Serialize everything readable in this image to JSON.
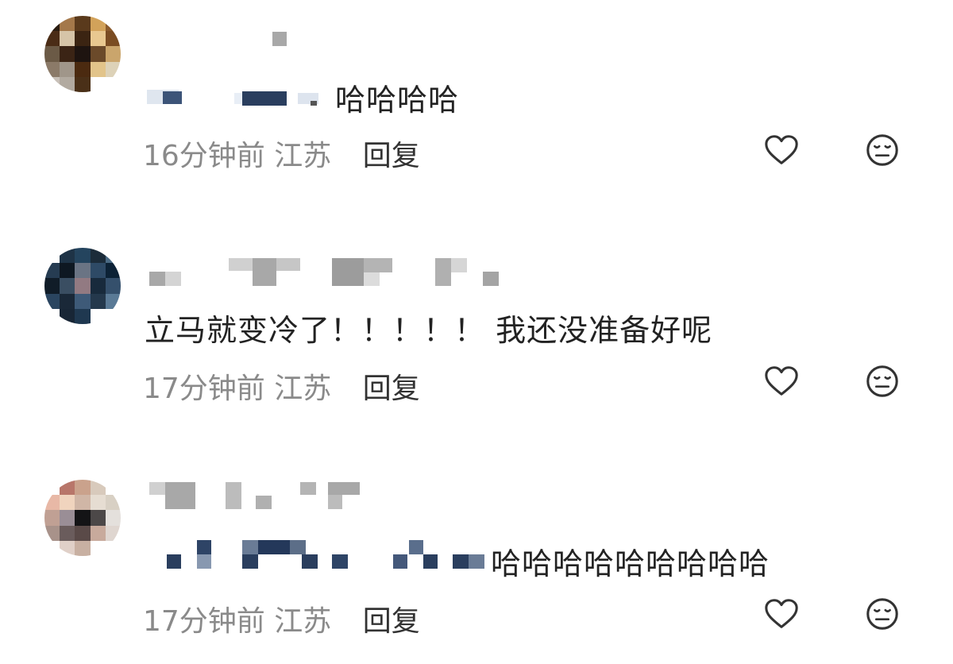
{
  "comments": [
    {
      "text": "哈哈哈哈",
      "time": "16分钟前",
      "location": "江苏",
      "reply_label": "回复",
      "like_icon": "heart-icon",
      "dislike_icon": "neutral-face-icon"
    },
    {
      "text": "立马就变冷了！！！！！ 我还没准备好呢",
      "time": "17分钟前",
      "location": "江苏",
      "reply_label": "回复",
      "like_icon": "heart-icon",
      "dislike_icon": "neutral-face-icon"
    },
    {
      "text": "哈哈哈哈哈哈哈哈哈",
      "time": "17分钟前",
      "location": "江苏",
      "reply_label": "回复",
      "like_icon": "heart-icon",
      "dislike_icon": "neutral-face-icon"
    }
  ],
  "colors": {
    "text": "#222222",
    "meta": "#8a8a8a",
    "reply": "#333333",
    "icon": "#333333",
    "mosaic_gray": "#a0a0a0",
    "mosaic_navy": "#2a3e5e"
  }
}
